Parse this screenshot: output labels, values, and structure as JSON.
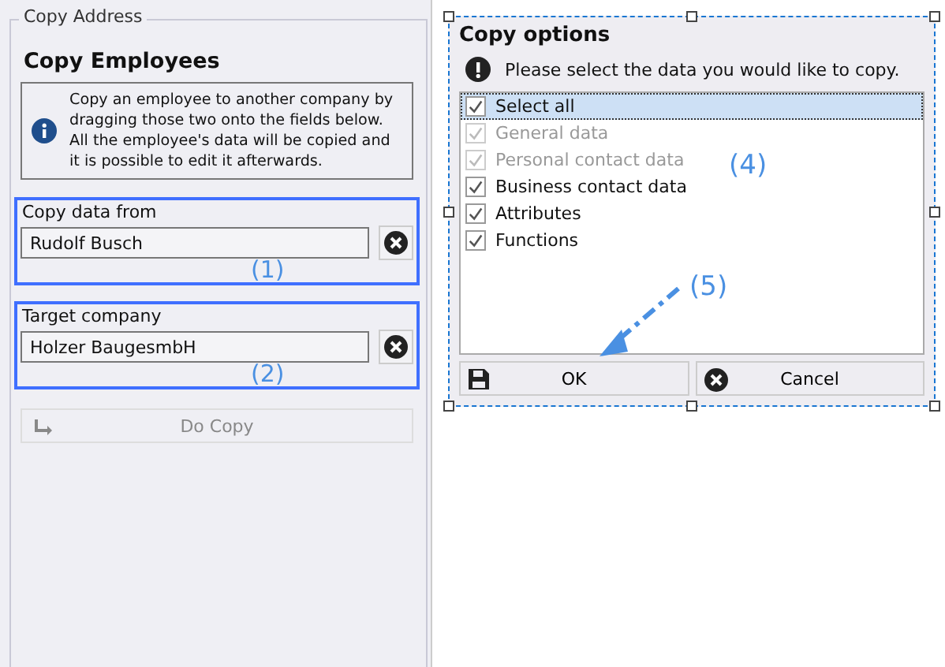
{
  "left_panel": {
    "group_title": "Copy Address",
    "heading": "Copy Employees",
    "info": "Copy an employee to another company by dragging those two onto the fields below. All the employee's data will be copied and it is possible to edit it afterwards.",
    "fields": [
      {
        "label": "Copy data from",
        "value": "Rudolf Busch",
        "annotation": "(1)"
      },
      {
        "label": "Target company",
        "value": "Holzer BaugesmbH",
        "annotation": "(2)"
      }
    ],
    "action_button": {
      "label": "Do Copy",
      "disabled": true
    }
  },
  "dialog": {
    "title": "Copy options",
    "message": "Please select the data you would like to copy.",
    "annotation": "(4)",
    "options": [
      {
        "label": "Select all",
        "checked": true,
        "disabled": false,
        "selected": true
      },
      {
        "label": "General data",
        "checked": true,
        "disabled": true,
        "selected": false
      },
      {
        "label": "Personal contact data",
        "checked": true,
        "disabled": true,
        "selected": false
      },
      {
        "label": "Business contact data",
        "checked": true,
        "disabled": false,
        "selected": false
      },
      {
        "label": "Attributes",
        "checked": true,
        "disabled": false,
        "selected": false
      },
      {
        "label": "Functions",
        "checked": true,
        "disabled": false,
        "selected": false
      }
    ],
    "buttons": [
      {
        "kind": "save",
        "label": "OK"
      },
      {
        "kind": "cancel",
        "label": "Cancel"
      }
    ],
    "arrow_annotation": "(5)"
  }
}
